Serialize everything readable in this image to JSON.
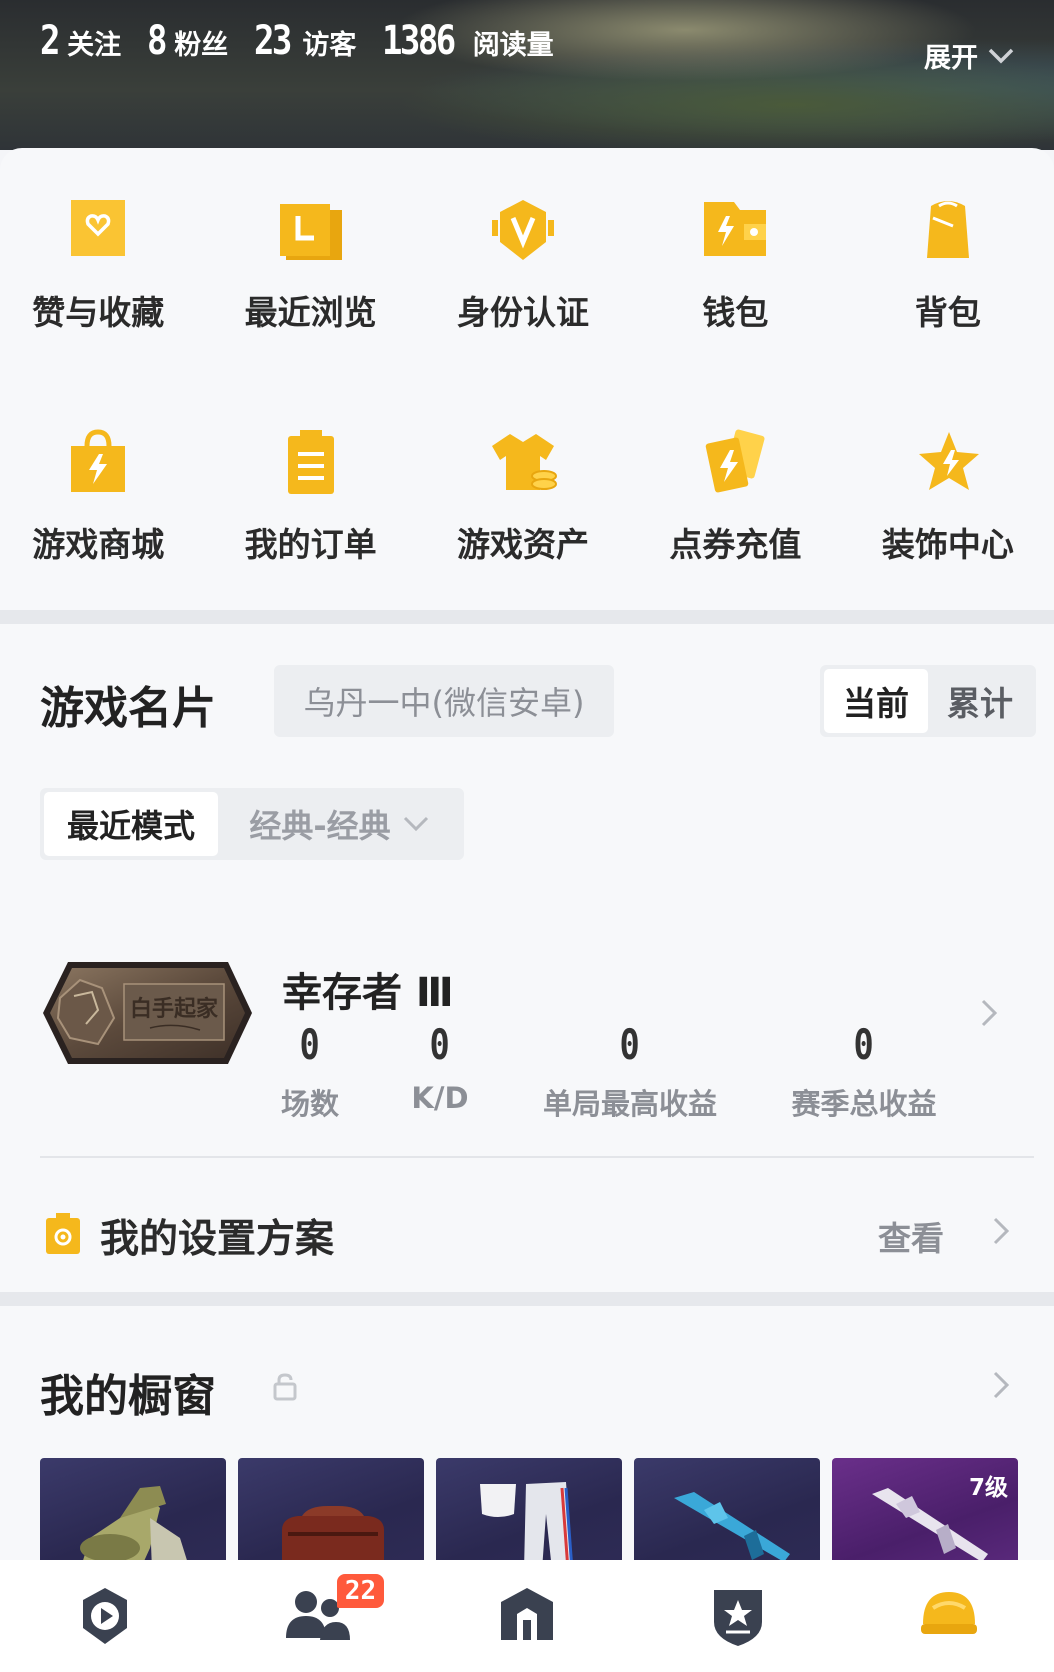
{
  "header": {
    "stats": [
      {
        "value": "2",
        "label": "关注"
      },
      {
        "value": "8",
        "label": "粉丝"
      },
      {
        "value": "23",
        "label": "访客"
      },
      {
        "value": "1386",
        "label": "阅读量"
      }
    ],
    "expand_label": "展开"
  },
  "shortcuts_row1": [
    {
      "label": "赞与收藏",
      "icon": "heart-favorite-icon"
    },
    {
      "label": "最近浏览",
      "icon": "history-folder-icon"
    },
    {
      "label": "身份认证",
      "icon": "verified-v-icon"
    },
    {
      "label": "钱包",
      "icon": "wallet-icon"
    },
    {
      "label": "背包",
      "icon": "backpack-icon"
    }
  ],
  "shortcuts_row2": [
    {
      "label": "游戏商城",
      "icon": "shopping-bag-icon"
    },
    {
      "label": "我的订单",
      "icon": "order-clipboard-icon"
    },
    {
      "label": "游戏资产",
      "icon": "tshirt-coins-icon"
    },
    {
      "label": "点券充值",
      "icon": "voucher-cards-icon"
    },
    {
      "label": "装饰中心",
      "icon": "star-decoration-icon"
    }
  ],
  "game_card": {
    "title": "游戏名片",
    "server": "乌丹一中(微信安卓)",
    "toggle": {
      "current": "当前",
      "cumulative": "累计"
    },
    "mode_label": "最近模式",
    "mode_value": "经典-经典",
    "badge_text": "白手起家",
    "rank_name": "幸存者 Ⅲ",
    "stats": [
      {
        "value": "0",
        "label": "场数"
      },
      {
        "value": "0",
        "label": "K/D"
      },
      {
        "value": "0",
        "label": "单局最高收益"
      },
      {
        "value": "0",
        "label": "赛季总收益"
      }
    ]
  },
  "settings_plan": {
    "title": "我的设置方案",
    "view_label": "查看"
  },
  "showcase": {
    "title": "我的橱窗",
    "items": [
      {
        "name": "camo-gear"
      },
      {
        "name": "leather-bag"
      },
      {
        "name": "sport-pants"
      },
      {
        "name": "blue-rifle"
      },
      {
        "name": "silver-rifle",
        "level": "7级"
      }
    ]
  },
  "tabbar": {
    "items": [
      {
        "icon": "video-play-icon"
      },
      {
        "icon": "friends-icon",
        "badge": "22"
      },
      {
        "icon": "home-icon"
      },
      {
        "icon": "rank-shield-icon"
      },
      {
        "icon": "helmet-profile-icon"
      }
    ]
  },
  "colors": {
    "accent": "#f5b81c",
    "accent_light": "#ffd24a",
    "dark_icon": "#3a4150"
  }
}
